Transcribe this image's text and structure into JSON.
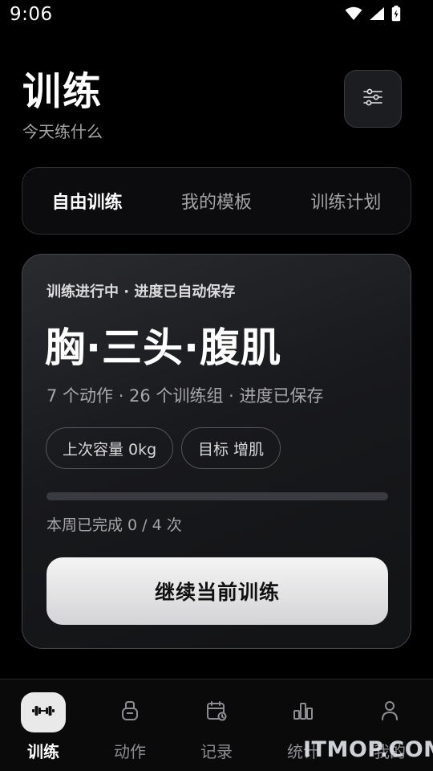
{
  "status_bar": {
    "time": "9:06"
  },
  "header": {
    "title": "训练",
    "subtitle": "今天练什么",
    "filter_icon": "sliders-icon"
  },
  "tabs": [
    {
      "label": "自由训练",
      "active": true
    },
    {
      "label": "我的模板",
      "active": false
    },
    {
      "label": "训练计划",
      "active": false
    }
  ],
  "workout_card": {
    "status": "训练进行中 · 进度已自动保存",
    "title": "胸·三头·腹肌",
    "meta": "7 个动作 · 26 个训练组 · 进度已保存",
    "volume_pill": "上次容量 0kg",
    "goal_pill": "目标 增肌",
    "progress_fraction": 0.0,
    "progress_label": "本周已完成 0 / 4 次",
    "continue_label": "继续当前训练"
  },
  "bottom_nav": [
    {
      "label": "训练",
      "icon": "dumbbell-icon",
      "active": true
    },
    {
      "label": "动作",
      "icon": "kettlebell-icon",
      "active": false
    },
    {
      "label": "记录",
      "icon": "calendar-icon",
      "active": false
    },
    {
      "label": "统计",
      "icon": "bar-chart-icon",
      "active": false
    },
    {
      "label": "我的",
      "icon": "user-icon",
      "active": false
    }
  ],
  "watermark": "ITMOP.COM",
  "colors": {
    "background": "#000000",
    "card": "#1c1d20",
    "accent": "#ffffff",
    "muted": "#a6a6a6"
  }
}
